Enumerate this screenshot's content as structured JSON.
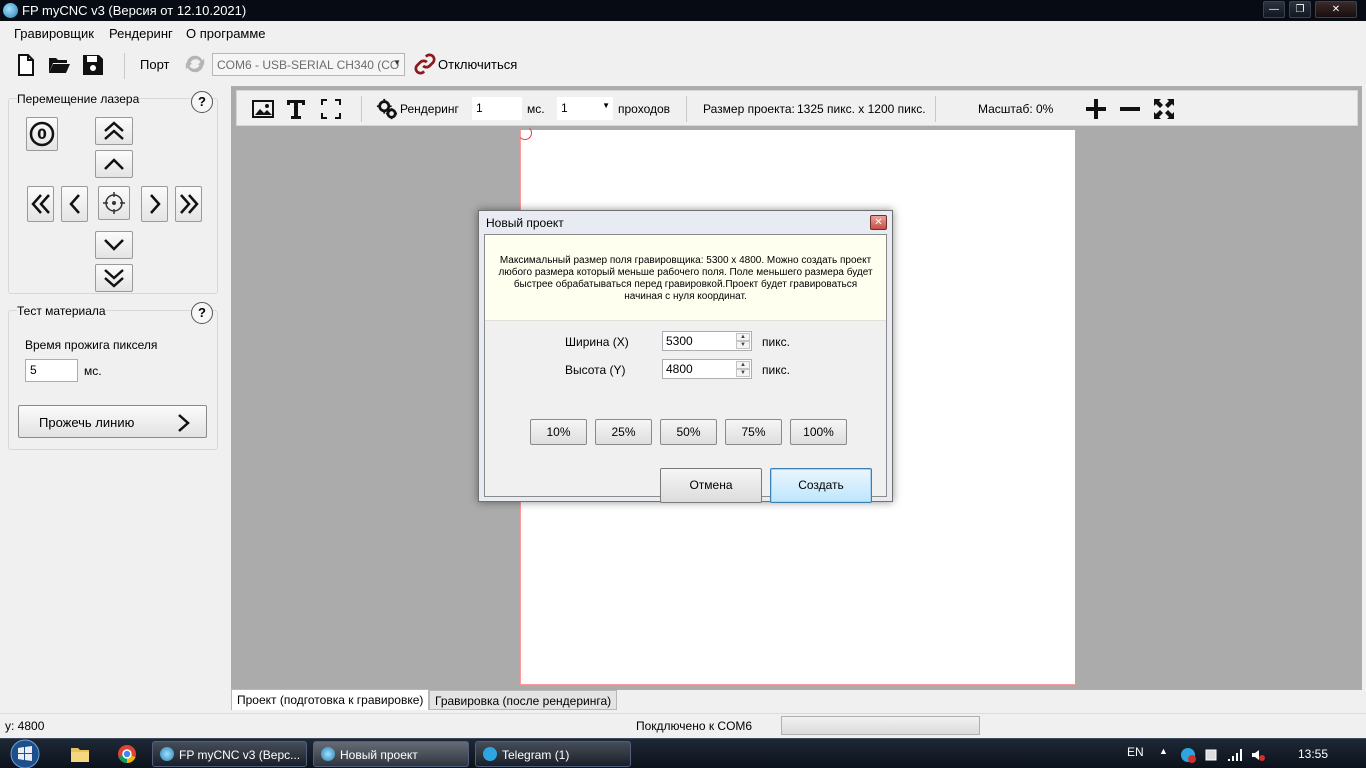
{
  "window": {
    "title": "FP myCNC v3 (Версия от 12.10.2021)"
  },
  "menu": [
    "Гравировщик",
    "Рендеринг",
    "О программе"
  ],
  "toolbar": {
    "port_label": "Порт",
    "com_port": "COM6 - USB-SERIAL CH340 (CO",
    "disconnect_label": "Отключиться"
  },
  "laser_panel": {
    "title": "Перемещение лазера",
    "help": "?"
  },
  "material_panel": {
    "title": "Тест материала",
    "help": "?",
    "burn_time_label": "Время прожига пикселя",
    "burn_time_value": "5",
    "burn_time_unit": "мс.",
    "burn_line_label": "Прожечь линию"
  },
  "work_toolbar": {
    "render_label": "Рендеринг",
    "render_ms_value": "1",
    "ms_unit": "мс.",
    "passes_value": "1",
    "passes_label": "проходов",
    "project_size_label": "Размер проекта:",
    "project_size_value": "1325 пикс. x 1200 пикс.",
    "scale_label": "Масштаб: 0%"
  },
  "tabs": [
    "Проект (подготовка к гравировке)",
    "Гравировка (после рендеринга)"
  ],
  "status": {
    "coords": "y: 4800",
    "connection": "Покдлючено к COM6"
  },
  "dialog": {
    "title": "Новый проект",
    "info": "Максимальный размер поля гравировщика: 5300 x 4800. Можно создать проект любого размера который меньше рабочего поля. Поле меньшего размера будет быстрее обрабатываться перед гравировкой.Проект будет гравироваться начиная с нуля координат.",
    "width_label": "Ширина (X)",
    "width_value": "5300",
    "height_label": "Высота (Y)",
    "height_value": "4800",
    "unit": "пикс.",
    "percent_buttons": [
      "10%",
      "25%",
      "50%",
      "75%",
      "100%"
    ],
    "cancel_label": "Отмена",
    "create_label": "Создать"
  },
  "taskbar": {
    "apps": [
      "FP myCNC v3 (Верс...",
      "Новый проект",
      "Telegram (1)"
    ],
    "lang": "EN",
    "clock": "13:55"
  }
}
